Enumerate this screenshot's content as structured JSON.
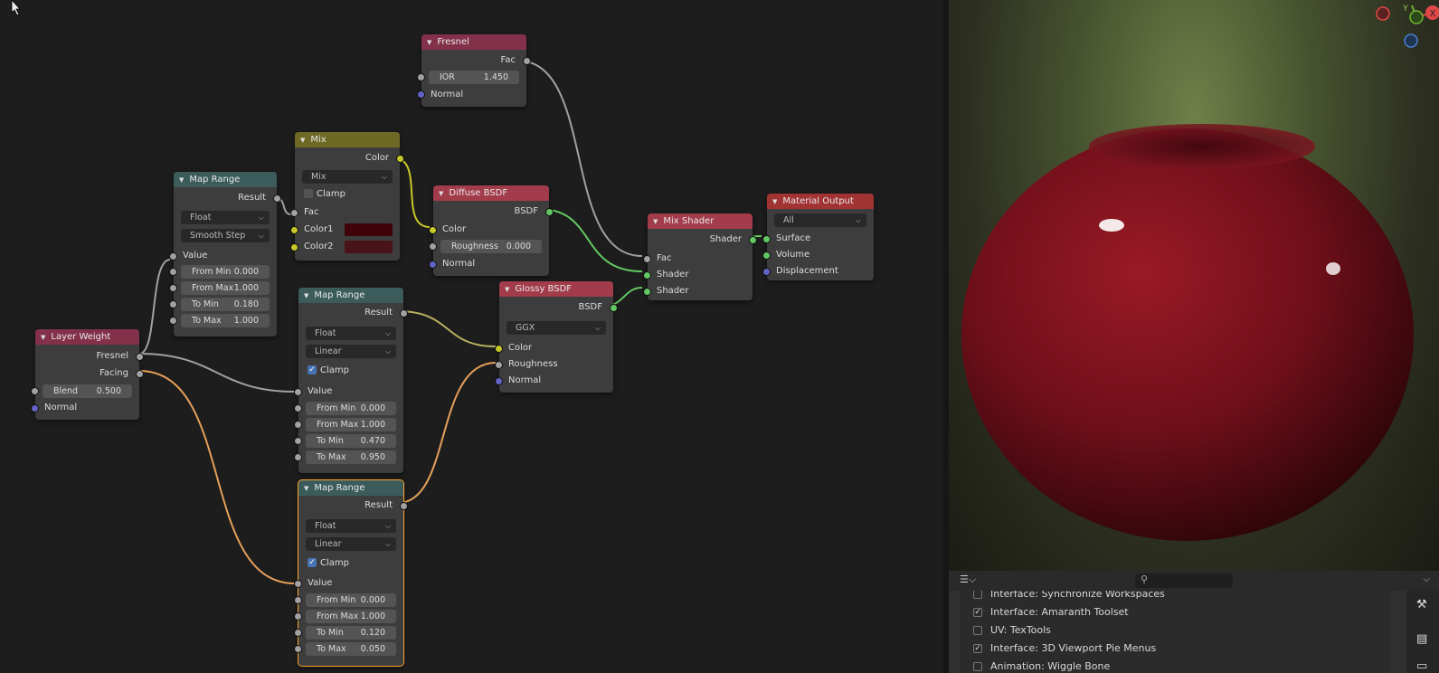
{
  "nodes": {
    "fresnel": {
      "title": "Fresnel",
      "fac": "Fac",
      "ior_label": "IOR",
      "ior_value": "1.450",
      "normal": "Normal"
    },
    "mix": {
      "title": "Mix",
      "color": "Color",
      "mode": "Mix",
      "clamp": "Clamp",
      "fac": "Fac",
      "color1": "Color1",
      "color2": "Color2",
      "color1_hex": "#3f0309",
      "color2_hex": "#4a1318"
    },
    "map_range_1": {
      "title": "Map Range",
      "result": "Result",
      "type": "Float",
      "interp": "Smooth Step",
      "value": "Value",
      "fields": [
        {
          "label": "From Min",
          "value": "0.000"
        },
        {
          "label": "From Max",
          "value": "1.000"
        },
        {
          "label": "To Min",
          "value": "0.180"
        },
        {
          "label": "To Max",
          "value": "1.000"
        }
      ]
    },
    "diffuse": {
      "title": "Diffuse BSDF",
      "bsdf": "BSDF",
      "color": "Color",
      "roughness_label": "Roughness",
      "roughness_value": "0.000",
      "normal": "Normal"
    },
    "mix_shader": {
      "title": "Mix Shader",
      "shader_out": "Shader",
      "fac": "Fac",
      "shader1": "Shader",
      "shader2": "Shader"
    },
    "material_output": {
      "title": "Material Output",
      "target": "All",
      "surface": "Surface",
      "volume": "Volume",
      "displacement": "Displacement"
    },
    "layer_weight": {
      "title": "Layer Weight",
      "fresnel": "Fresnel",
      "facing": "Facing",
      "blend_label": "Blend",
      "blend_value": "0.500",
      "normal": "Normal"
    },
    "map_range_2": {
      "title": "Map Range",
      "result": "Result",
      "type": "Float",
      "interp": "Linear",
      "clamp": "Clamp",
      "value": "Value",
      "fields": [
        {
          "label": "From Min",
          "value": "0.000"
        },
        {
          "label": "From Max",
          "value": "1.000"
        },
        {
          "label": "To Min",
          "value": "0.470"
        },
        {
          "label": "To Max",
          "value": "0.950"
        }
      ]
    },
    "glossy": {
      "title": "Glossy BSDF",
      "bsdf": "BSDF",
      "distribution": "GGX",
      "color": "Color",
      "roughness": "Roughness",
      "normal": "Normal"
    },
    "map_range_3": {
      "title": "Map Range",
      "result": "Result",
      "type": "Float",
      "interp": "Linear",
      "clamp": "Clamp",
      "value": "Value",
      "fields": [
        {
          "label": "From Min",
          "value": "0.000"
        },
        {
          "label": "From Max",
          "value": "1.000"
        },
        {
          "label": "To Min",
          "value": "0.120"
        },
        {
          "label": "To Max",
          "value": "0.050"
        }
      ]
    }
  },
  "gizmo": {
    "x": "X",
    "y": "Y"
  },
  "preferences": {
    "items": [
      {
        "label": "Interface: Synchronize Workspaces",
        "checked": false
      },
      {
        "label": "Interface: Amaranth Toolset",
        "checked": true
      },
      {
        "label": "UV: TexTools",
        "checked": false
      },
      {
        "label": "Interface: 3D Viewport Pie Menus",
        "checked": true
      },
      {
        "label": "Animation: Wiggle Bone",
        "checked": false
      }
    ]
  },
  "colors": {
    "apple": "#7a111c",
    "wire_shader": "#63c763",
    "wire_color": "#c7c729",
    "wire_float": "#a1a1a1",
    "wire_active": "#e6a05a"
  }
}
